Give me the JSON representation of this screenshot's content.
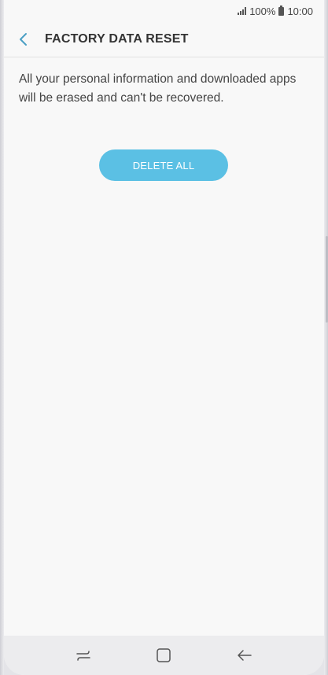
{
  "status_bar": {
    "battery": "100%",
    "time": "10:00"
  },
  "header": {
    "title": "FACTORY DATA RESET"
  },
  "content": {
    "description": "All your personal information and downloaded apps will be erased and can't be recovered."
  },
  "actions": {
    "delete_label": "DELETE ALL"
  },
  "colors": {
    "accent": "#5bc0e4",
    "back_arrow": "#4a9fc4",
    "background": "#f8f8f8"
  },
  "nav": {
    "icons": [
      "recent-apps-icon",
      "home-icon",
      "back-icon"
    ]
  }
}
